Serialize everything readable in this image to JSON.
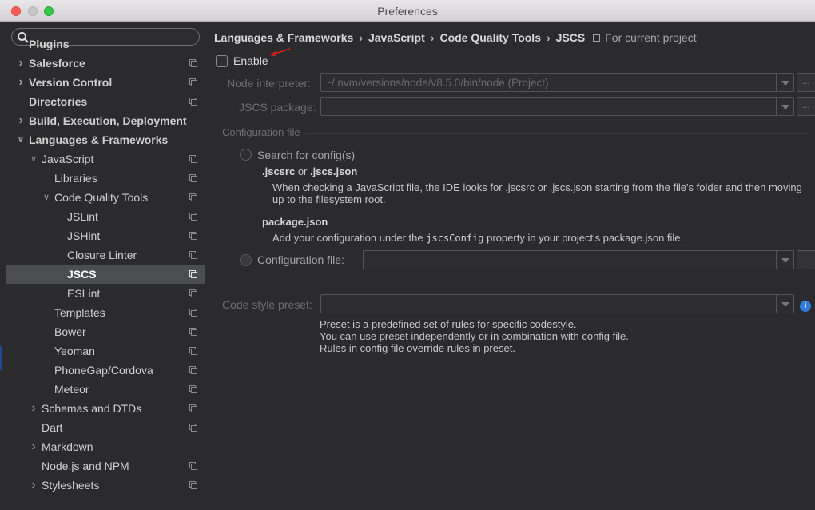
{
  "window": {
    "title": "Preferences"
  },
  "sidebar": {
    "search": {
      "value": ""
    },
    "items": [
      {
        "label": "Plugins",
        "indent": 0,
        "arrow": "",
        "bold": true,
        "icon": false,
        "selected": false
      },
      {
        "label": "Salesforce",
        "indent": 0,
        "arrow": "right",
        "bold": true,
        "icon": true,
        "selected": false
      },
      {
        "label": "Version Control",
        "indent": 0,
        "arrow": "right",
        "bold": true,
        "icon": true,
        "selected": false
      },
      {
        "label": "Directories",
        "indent": 0,
        "arrow": "",
        "bold": true,
        "icon": true,
        "selected": false
      },
      {
        "label": "Build, Execution, Deployment",
        "indent": 0,
        "arrow": "right",
        "bold": true,
        "icon": false,
        "selected": false
      },
      {
        "label": "Languages & Frameworks",
        "indent": 0,
        "arrow": "down",
        "bold": true,
        "icon": false,
        "selected": false
      },
      {
        "label": "JavaScript",
        "indent": 1,
        "arrow": "down",
        "bold": false,
        "icon": true,
        "selected": false
      },
      {
        "label": "Libraries",
        "indent": 2,
        "arrow": "",
        "bold": false,
        "icon": true,
        "selected": false
      },
      {
        "label": "Code Quality Tools",
        "indent": 2,
        "arrow": "down",
        "bold": false,
        "icon": true,
        "selected": false
      },
      {
        "label": "JSLint",
        "indent": 3,
        "arrow": "",
        "bold": false,
        "icon": true,
        "selected": false
      },
      {
        "label": "JSHint",
        "indent": 3,
        "arrow": "",
        "bold": false,
        "icon": true,
        "selected": false
      },
      {
        "label": "Closure Linter",
        "indent": 3,
        "arrow": "",
        "bold": false,
        "icon": true,
        "selected": false
      },
      {
        "label": "JSCS",
        "indent": 3,
        "arrow": "",
        "bold": true,
        "icon": true,
        "selected": true
      },
      {
        "label": "ESLint",
        "indent": 3,
        "arrow": "",
        "bold": false,
        "icon": true,
        "selected": false
      },
      {
        "label": "Templates",
        "indent": 2,
        "arrow": "",
        "bold": false,
        "icon": true,
        "selected": false
      },
      {
        "label": "Bower",
        "indent": 2,
        "arrow": "",
        "bold": false,
        "icon": true,
        "selected": false
      },
      {
        "label": "Yeoman",
        "indent": 2,
        "arrow": "",
        "bold": false,
        "icon": true,
        "selected": false
      },
      {
        "label": "PhoneGap/Cordova",
        "indent": 2,
        "arrow": "",
        "bold": false,
        "icon": true,
        "selected": false
      },
      {
        "label": "Meteor",
        "indent": 2,
        "arrow": "",
        "bold": false,
        "icon": true,
        "selected": false
      },
      {
        "label": "Schemas and DTDs",
        "indent": 1,
        "arrow": "right",
        "bold": false,
        "icon": true,
        "selected": false
      },
      {
        "label": "Dart",
        "indent": 1,
        "arrow": "",
        "bold": false,
        "icon": true,
        "selected": false
      },
      {
        "label": "Markdown",
        "indent": 1,
        "arrow": "right",
        "bold": false,
        "icon": false,
        "selected": false
      },
      {
        "label": "Node.js and NPM",
        "indent": 1,
        "arrow": "",
        "bold": false,
        "icon": true,
        "selected": false
      },
      {
        "label": "Stylesheets",
        "indent": 1,
        "arrow": "right",
        "bold": false,
        "icon": true,
        "selected": false
      }
    ]
  },
  "breadcrumb": {
    "segments": [
      "Languages & Frameworks",
      "JavaScript",
      "Code Quality Tools",
      "JSCS"
    ],
    "separator": "›",
    "project_label": "For current project"
  },
  "form": {
    "enable_label": "Enable",
    "enable_checked": false,
    "node_interpreter": {
      "label": "Node interpreter:",
      "value": "~/.nvm/versions/node/v8.5.0/bin/node  (Project)"
    },
    "jscs_package": {
      "label": "JSCS package:",
      "value": ""
    },
    "browse_label": "...",
    "config_section_title": "Configuration file",
    "search_config": {
      "label": "Search for config(s)",
      "head_1": ".jscsrc",
      "head_or": "or",
      "head_2": ".jscs.json",
      "desc_1": "When checking a JavaScript file, the IDE looks for .jscsrc or .jscs.json starting from the file's folder and then moving up to the filesystem root.",
      "pkg_head": "package.json",
      "pkg_desc_pre": "Add your configuration under the",
      "pkg_desc_code": "jscsConfig",
      "pkg_desc_post": "property in your project's package.json file."
    },
    "config_file": {
      "label": "Configuration file:",
      "value": ""
    },
    "code_style_preset": {
      "label": "Code style preset:",
      "value": ""
    },
    "info_glyph": "i",
    "preset_desc": [
      "Preset is a predefined set of rules for specific codestyle.",
      "You can use preset independently or in combination with config file.",
      "Rules in config file override rules in preset."
    ]
  },
  "colors": {
    "accent": "#2e7bd8",
    "selection": "#4b4d50",
    "annotation_arrow": "#e02020"
  }
}
